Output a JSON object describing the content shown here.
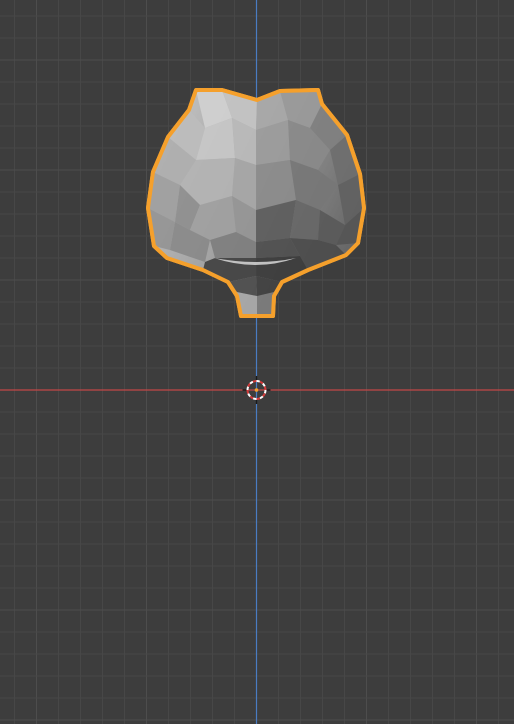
{
  "viewport": {
    "background_color": "#3d3d3d",
    "grid_minor_color": "#474747",
    "grid_major_color": "#4d4d4d",
    "x_axis_color": "#c34747",
    "y_axis_color": "#4a7cc2",
    "selection_outline_color": "#f5a02c"
  },
  "selected_object": {
    "icon": "mesh-object-icon",
    "selected": true
  },
  "cursor_3d": {
    "icon": "3d-cursor-icon"
  }
}
